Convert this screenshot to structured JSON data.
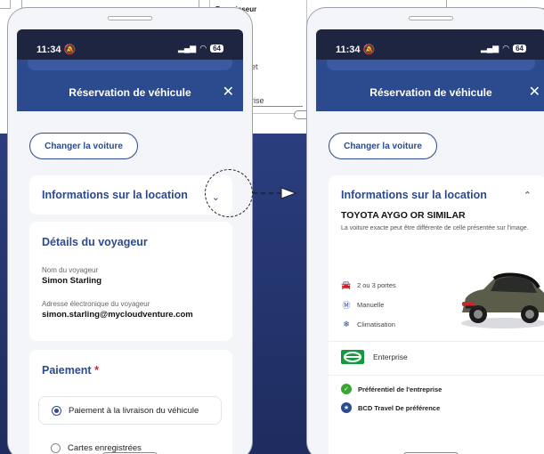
{
  "background": {
    "doc_label": "Fournisseur",
    "doc_text_1": "et",
    "doc_text_2": "rise"
  },
  "left_phone": {
    "time": "11:34",
    "battery": "64",
    "header_title": "Réservation de véhicule",
    "change_car_label": "Changer la voiture",
    "rental_info_heading": "Informations sur la location",
    "traveler_heading": "Détails du voyageur",
    "traveler_name_label": "Nom du voyageur",
    "traveler_name": "Simon Starling",
    "email_label": "Adresse électronique du voyageur",
    "email": "simon.starling@mycloudventure.com",
    "payment_heading": "Paiement",
    "payment_required_mark": "*",
    "payment_option_1": "Paiement à la livraison du véhicule",
    "payment_option_2": "Cartes enregistrées"
  },
  "right_phone": {
    "time": "11:34",
    "battery": "64",
    "header_title": "Réservation de véhicule",
    "change_car_label": "Changer la voiture",
    "rental_info_heading": "Informations sur la location",
    "car_model": "TOYOTA AYGO OR SIMILAR",
    "car_disclaimer": "La voiture exacte peut être différente de celle présentée sur l'image.",
    "features": [
      {
        "icon": "car-icon",
        "label": "2 ou 3 portes"
      },
      {
        "icon": "transmission-icon",
        "label": "Manuelle"
      },
      {
        "icon": "snowflake-icon",
        "label": "Climatisation"
      }
    ],
    "supplier_name": "Enterprise",
    "badges": [
      {
        "icon": "check-badge-icon",
        "label": "Préférentiel de l'entreprise",
        "color": "#3aa535"
      },
      {
        "icon": "star-badge-icon",
        "label": "BCD Travel De préférence",
        "color": "#2c4a8e"
      }
    ]
  },
  "colors": {
    "brand_blue": "#2c4a8e",
    "status_bar": "#1d2541",
    "enterprise_green": "#169a3f",
    "required_red": "#d4233a"
  }
}
